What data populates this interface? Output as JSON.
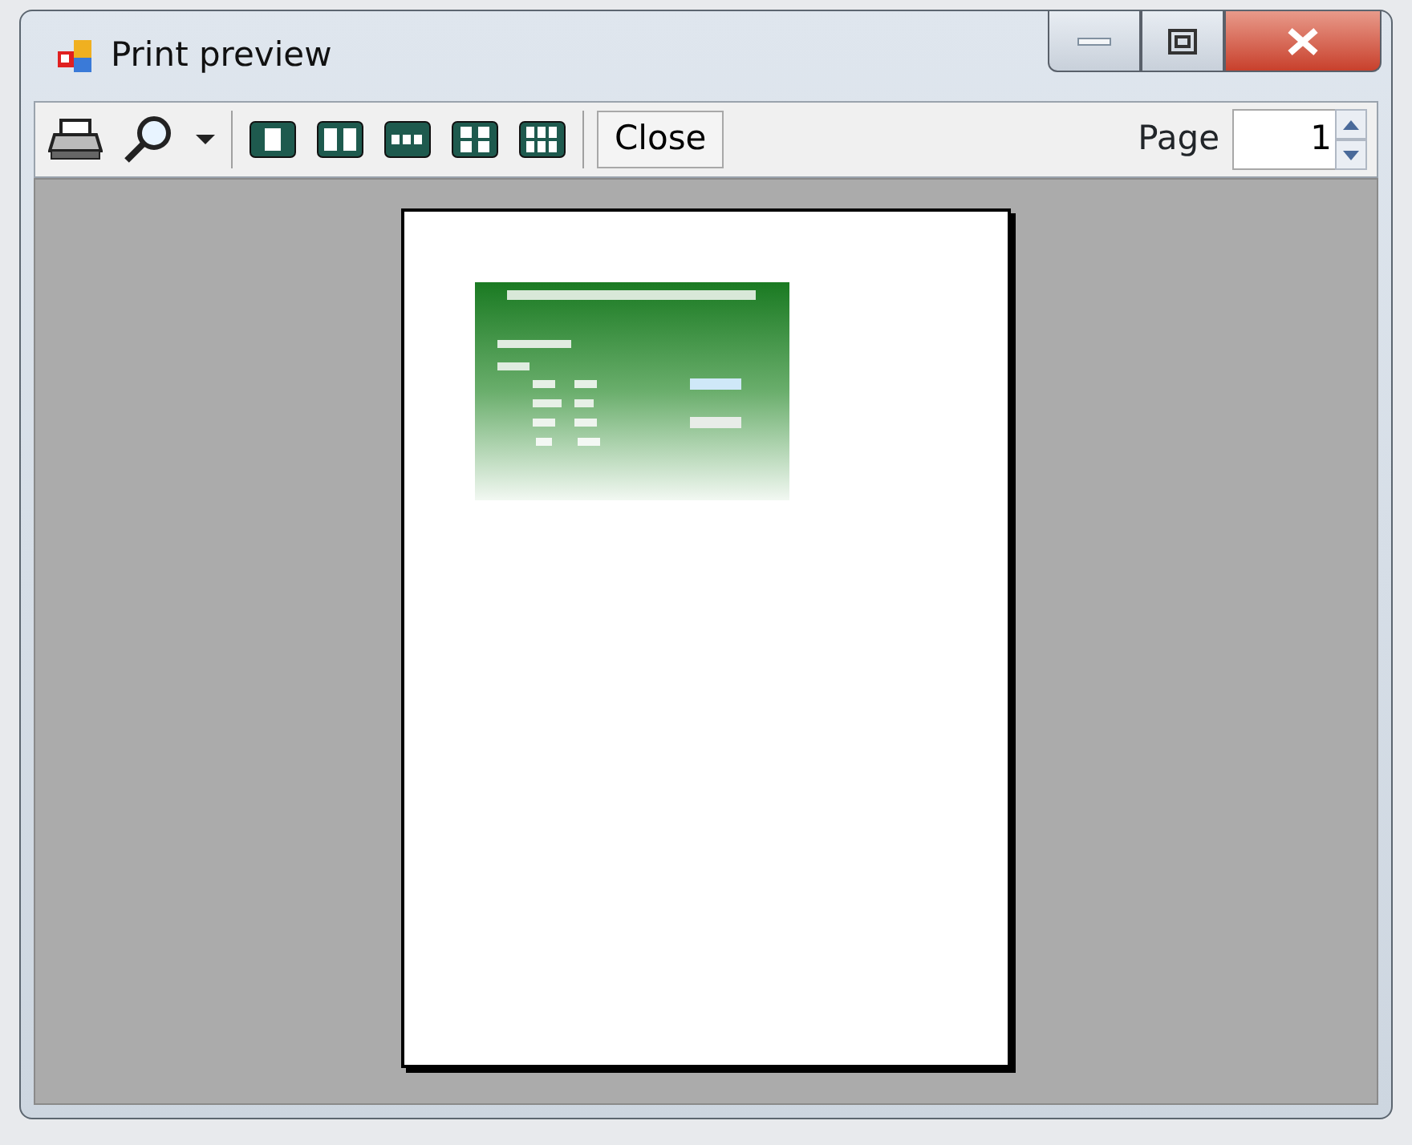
{
  "window": {
    "title": "Print preview"
  },
  "toolbar": {
    "close_button": "Close",
    "page_label": "Page",
    "page_field": {
      "value": "1"
    }
  }
}
